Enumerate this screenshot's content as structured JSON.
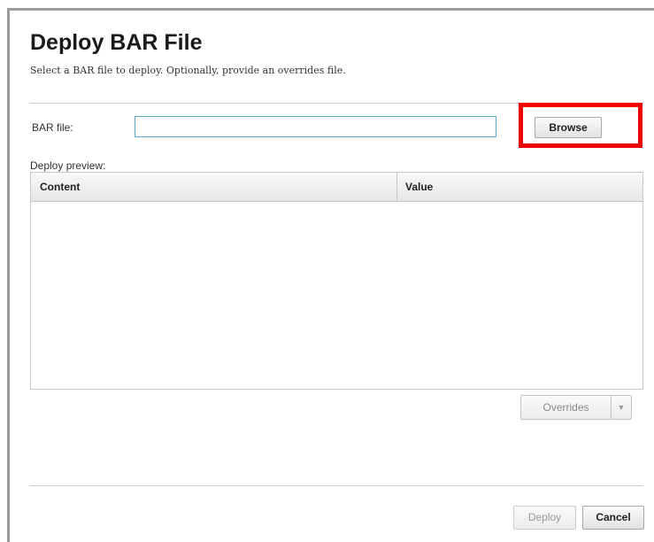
{
  "dialog": {
    "title": "Deploy BAR File",
    "subtitle": "Select a BAR file to deploy. Optionally, provide an overrides file."
  },
  "bar_file": {
    "label": "BAR file:",
    "value": "",
    "browse_label": "Browse"
  },
  "preview": {
    "label": "Deploy preview:",
    "columns": [
      "Content",
      "Value"
    ],
    "rows": []
  },
  "overrides": {
    "label": "Overrides",
    "arrow_icon": "chevron-down-icon"
  },
  "footer": {
    "deploy_label": "Deploy",
    "cancel_label": "Cancel"
  },
  "colors": {
    "highlight": "#ee0000",
    "input_border": "#5aa7c8"
  }
}
